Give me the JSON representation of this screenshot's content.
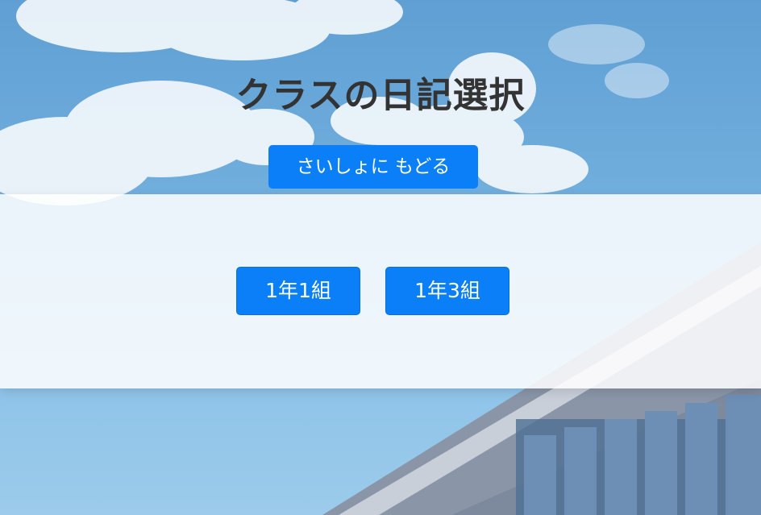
{
  "page": {
    "title": "クラスの日記選択"
  },
  "navigation": {
    "back_label": "さいしょに もどる"
  },
  "class_list": {
    "items": [
      {
        "label": "1年1組"
      },
      {
        "label": "1年3組"
      }
    ]
  },
  "theme": {
    "accent": "#0a7ff7",
    "title_color": "#333333",
    "sky_top": "#5f9fd3",
    "sky_bottom": "#9ccbeb"
  }
}
